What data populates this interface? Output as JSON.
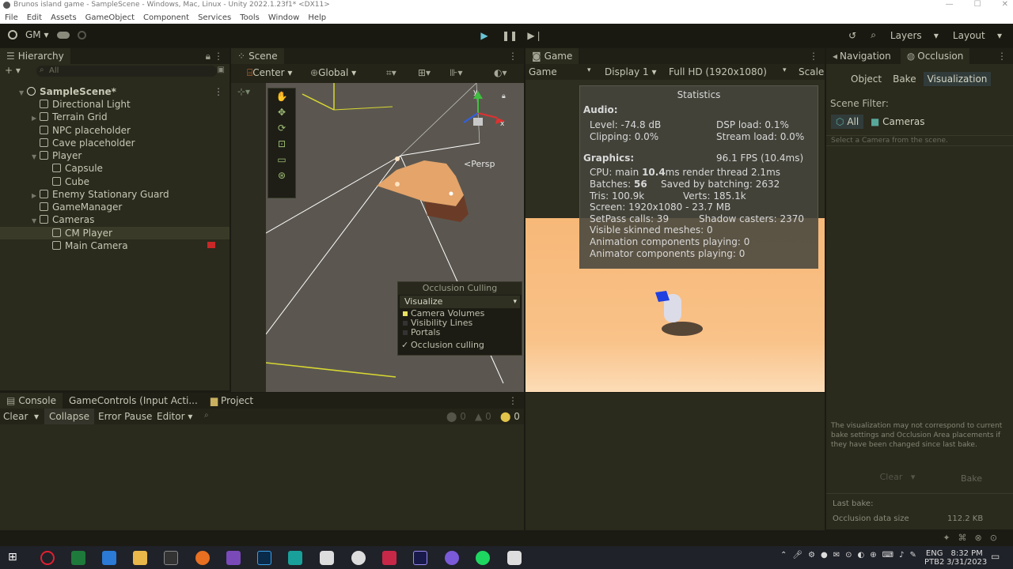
{
  "window": {
    "title": "Brunos island game - SampleScene - Windows, Mac, Linux - Unity 2022.1.23f1* <DX11>"
  },
  "menu": [
    "File",
    "Edit",
    "Assets",
    "GameObject",
    "Component",
    "Services",
    "Tools",
    "Window",
    "Help"
  ],
  "toolbar": {
    "account": "GM",
    "layers": "Layers",
    "layout": "Layout"
  },
  "hierarchy": {
    "tab": "Hierarchy",
    "search_placeholder": "All",
    "items": [
      {
        "label": "SampleScene*",
        "depth": 0
      },
      {
        "label": "Directional Light",
        "depth": 1
      },
      {
        "label": "Terrain Grid",
        "depth": 1
      },
      {
        "label": "NPC placeholder",
        "depth": 1
      },
      {
        "label": "Cave placeholder",
        "depth": 1
      },
      {
        "label": "Player",
        "depth": 1
      },
      {
        "label": "Capsule",
        "depth": 2
      },
      {
        "label": "Cube",
        "depth": 2
      },
      {
        "label": "Enemy Stationary Guard",
        "depth": 1
      },
      {
        "label": "GameManager",
        "depth": 1
      },
      {
        "label": "Cameras",
        "depth": 1
      },
      {
        "label": "CM Player",
        "depth": 2
      },
      {
        "label": "Main Camera",
        "depth": 2
      }
    ]
  },
  "scene": {
    "tab": "Scene",
    "pivot": "Center",
    "space": "Global",
    "persp": "<Persp",
    "occlusion": {
      "title": "Occlusion Culling",
      "mode": "Visualize",
      "items": [
        "Camera Volumes",
        "Visibility Lines",
        "Portals",
        "Occlusion culling"
      ]
    }
  },
  "game": {
    "tab": "Game",
    "view": "Game",
    "display": "Display 1",
    "resolution": "Full HD (1920x1080)",
    "scale": "Scale",
    "stats": {
      "title": "Statistics",
      "audio_h": "Audio:",
      "level": "Level: -74.8 dB",
      "clipping": "Clipping: 0.0%",
      "dsp": "DSP load: 0.1%",
      "stream": "Stream load: 0.0%",
      "graphics_h": "Graphics:",
      "fps": "96.1 FPS (10.4ms)",
      "cpu_a": "CPU: main ",
      "cpu_b": "10.4",
      "cpu_c": "ms  render thread 2.1ms",
      "batches_a": "Batches: ",
      "batches_b": "56",
      "saved": "Saved by batching: 2632",
      "tris": "Tris: 100.9k",
      "verts": "Verts: 185.1k",
      "screen": "Screen: 1920x1080 - 23.7 MB",
      "setpass": "SetPass calls: 39",
      "shadow": "Shadow casters: 2370",
      "skinned": "Visible skinned meshes: 0",
      "anim": "Animation components playing: 0",
      "animator": "Animator components playing: 0"
    }
  },
  "navigation": {
    "tab_nav": "Navigation",
    "tab_occ": "Occlusion",
    "buttons": [
      "Object",
      "Bake",
      "Visualization"
    ],
    "scene_filter": "Scene Filter:",
    "filter_all": "All",
    "filter_cameras": "Cameras",
    "hint": "Select a Camera from the scene.",
    "warning": "The visualization may not correspond to current bake settings and Occlusion Area placements if they have been changed since last bake.",
    "clear": "Clear",
    "bake": "Bake",
    "last_bake": "Last bake:",
    "occ_size_label": "Occlusion data size",
    "occ_size_value": "112.2 KB"
  },
  "console": {
    "tab_console": "Console",
    "tab_controls": "GameControls (Input Acti...",
    "tab_project": "Project",
    "clear": "Clear",
    "collapse": "Collapse",
    "error_pause": "Error Pause",
    "editor": "Editor",
    "count_warn": "0",
    "count_info": "0",
    "count_err": "0"
  },
  "taskbar": {
    "lang1": "ENG",
    "lang2": "PTB2",
    "time": "8:32 PM",
    "date": "3/31/2023"
  },
  "colors": {
    "bg": "#2a2a1d",
    "accent": "#69c4d6",
    "ground": "#f7b878"
  }
}
